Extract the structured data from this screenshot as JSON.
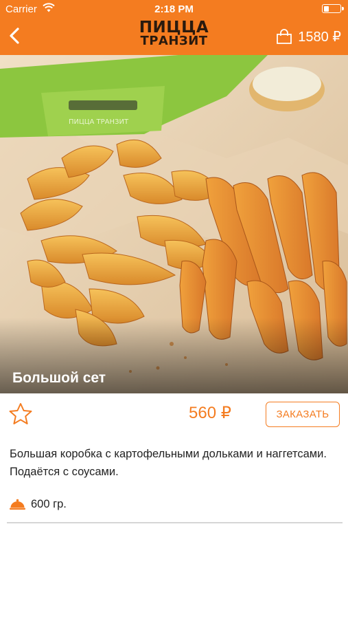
{
  "status_bar": {
    "carrier": "Carrier",
    "time": "2:18 PM",
    "battery_level": 0.35
  },
  "nav": {
    "logo_line1": "ПИЦЦА",
    "logo_line2": "ТРАНЗИТ",
    "cart_total": "1580 ₽"
  },
  "product": {
    "title": "Большой сет",
    "price": "560 ₽",
    "order_label": "ЗАКАЗАТЬ",
    "description": "Большая коробка с картофельными дольками и наггетсами. Подаётся с соусами.",
    "weight": "600 гр.",
    "favorite": false
  },
  "colors": {
    "accent": "#f47c20",
    "text": "#222222",
    "divider": "#d6d6d6"
  },
  "icons": [
    "chevron-left-icon",
    "wifi-icon",
    "battery-icon",
    "shopping-bag-icon",
    "star-outline-icon",
    "food-dome-icon"
  ]
}
